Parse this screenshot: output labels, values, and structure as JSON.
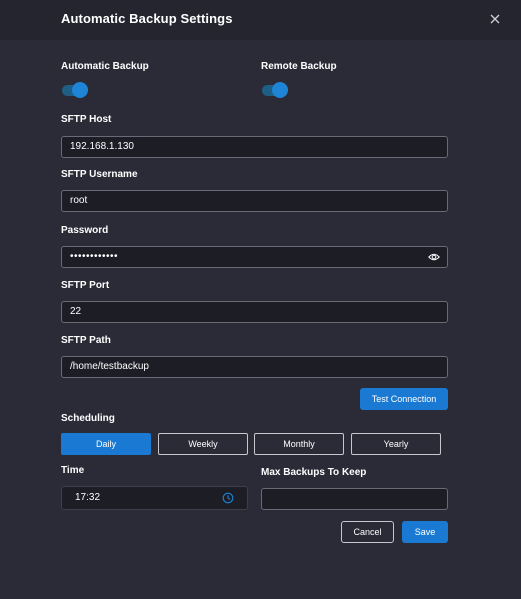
{
  "dialog": {
    "title": "Automatic Backup Settings",
    "close_icon": "close-icon"
  },
  "toggles": {
    "automatic_backup": {
      "label": "Automatic Backup",
      "on": true
    },
    "remote_backup": {
      "label": "Remote Backup",
      "on": true
    }
  },
  "sftp": {
    "host_label": "SFTP Host",
    "host_value": "192.168.1.130",
    "username_label": "SFTP Username",
    "username_value": "root",
    "password_label": "Password",
    "password_value": "••••••••••••",
    "port_label": "SFTP Port",
    "port_value": "22",
    "path_label": "SFTP Path",
    "path_value": "/home/testbackup",
    "test_button": "Test Connection"
  },
  "scheduling": {
    "label": "Scheduling",
    "options": [
      "Daily",
      "Weekly",
      "Monthly",
      "Yearly"
    ],
    "selected": "Daily"
  },
  "time": {
    "label": "Time",
    "value": "17:32"
  },
  "max_backups": {
    "label": "Max Backups To Keep",
    "value": ""
  },
  "actions": {
    "cancel": "Cancel",
    "save": "Save"
  },
  "colors": {
    "accent": "#1a7ad3",
    "background": "#2b2b37",
    "header": "#252530",
    "input_bg": "#1d1d26"
  }
}
